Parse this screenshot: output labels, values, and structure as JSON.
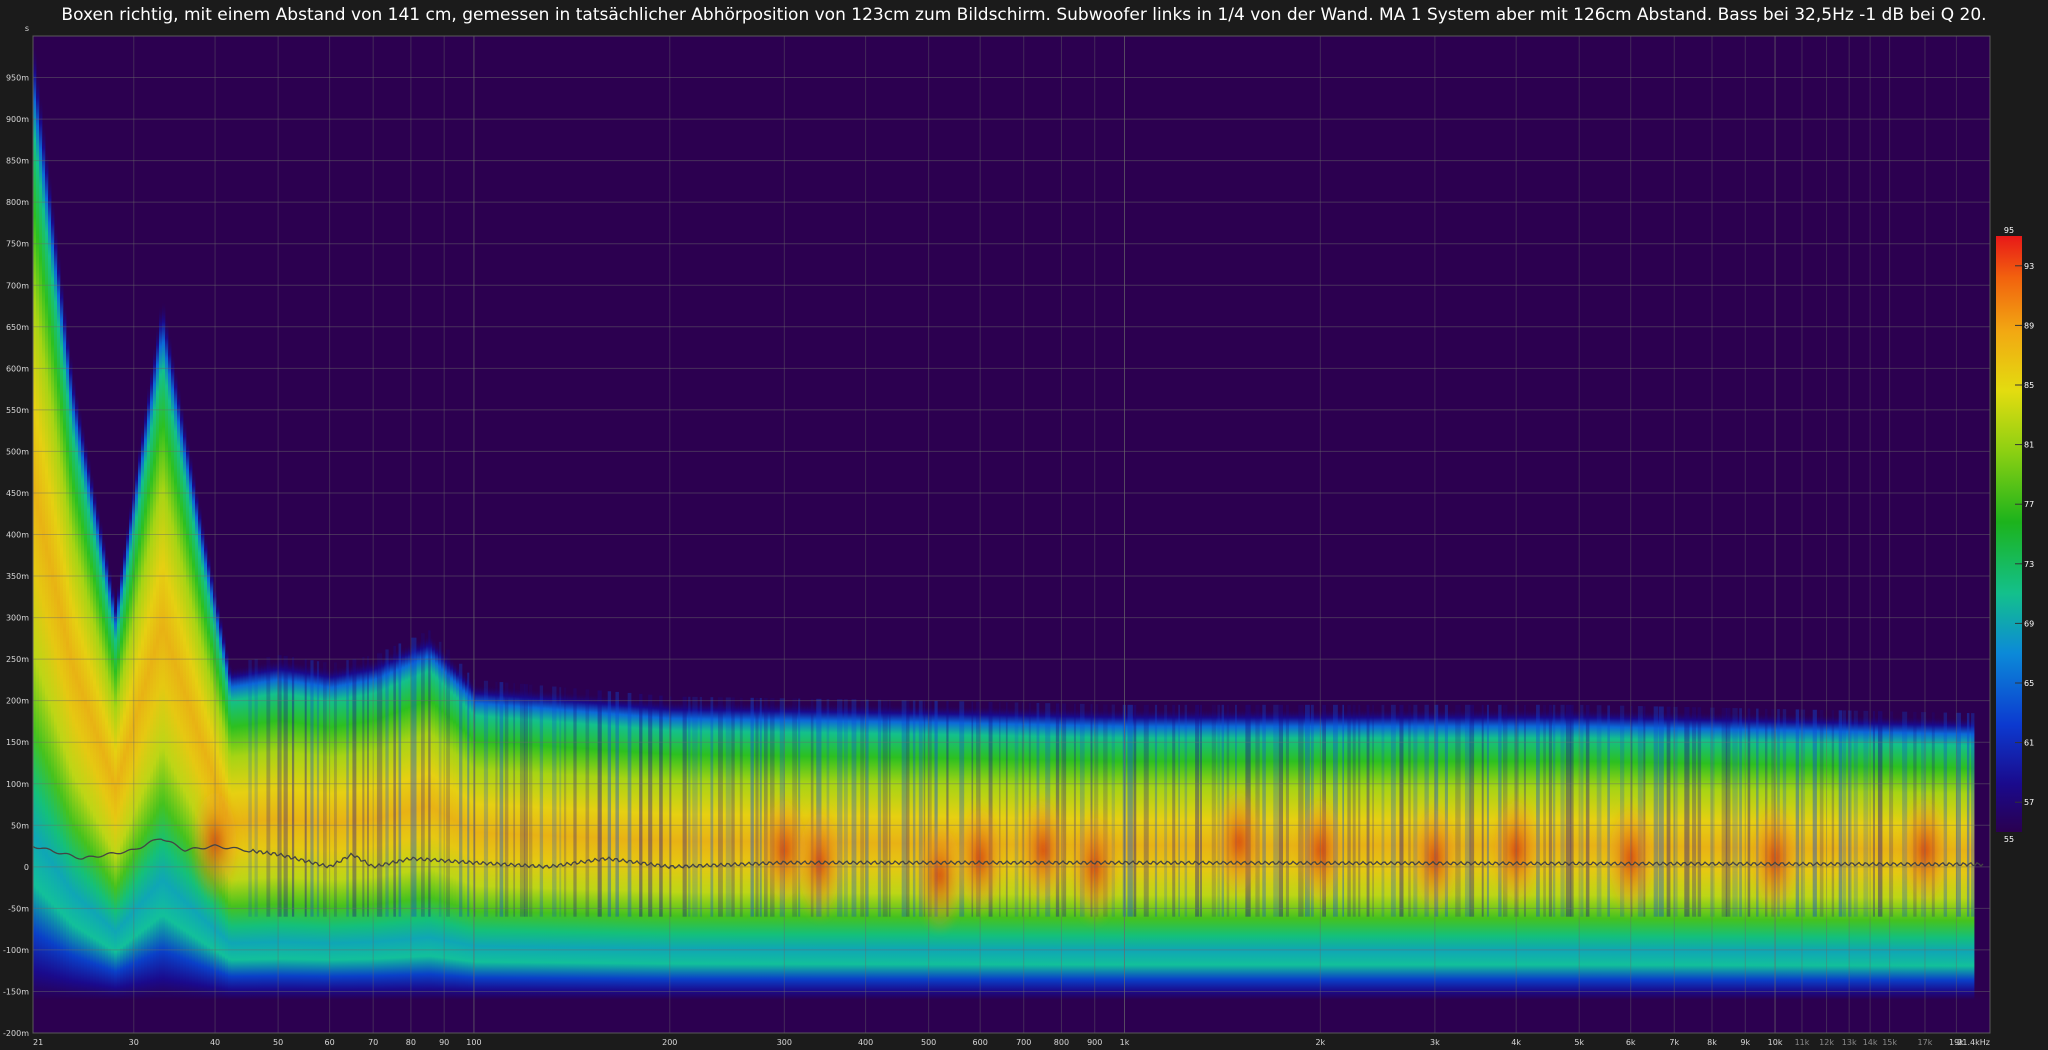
{
  "chart_data": {
    "type": "heatmap",
    "title": "Boxen richtig, mit einem Abstand von 141 cm, gemessen in tatsächlicher Abhörposition von 123cm zum Bildschirm. Subwoofer links in 1/4 von der Wand. MA 1 System aber mit 126cm Abstand. Bass bei 32,5Hz -1 dB bei Q 20.",
    "x_scale": "log",
    "xlim": [
      21,
      21400
    ],
    "ylim": [
      -200,
      1000
    ],
    "y_unit_label": "s",
    "x_ticks": [
      {
        "value": 21,
        "label": "21"
      },
      {
        "value": 30,
        "label": "30"
      },
      {
        "value": 40,
        "label": "40"
      },
      {
        "value": 50,
        "label": "50"
      },
      {
        "value": 60,
        "label": "60"
      },
      {
        "value": 70,
        "label": "70"
      },
      {
        "value": 80,
        "label": "80"
      },
      {
        "value": 90,
        "label": "90"
      },
      {
        "value": 100,
        "label": "100"
      },
      {
        "value": 200,
        "label": "200"
      },
      {
        "value": 300,
        "label": "300"
      },
      {
        "value": 400,
        "label": "400"
      },
      {
        "value": 500,
        "label": "500"
      },
      {
        "value": 600,
        "label": "600"
      },
      {
        "value": 700,
        "label": "700"
      },
      {
        "value": 800,
        "label": "800"
      },
      {
        "value": 900,
        "label": "900"
      },
      {
        "value": 1000,
        "label": "1k"
      },
      {
        "value": 2000,
        "label": "2k"
      },
      {
        "value": 3000,
        "label": "3k"
      },
      {
        "value": 4000,
        "label": "4k"
      },
      {
        "value": 5000,
        "label": "5k"
      },
      {
        "value": 6000,
        "label": "6k"
      },
      {
        "value": 7000,
        "label": "7k"
      },
      {
        "value": 8000,
        "label": "8k"
      },
      {
        "value": 9000,
        "label": "9k"
      },
      {
        "value": 10000,
        "label": "10k"
      },
      {
        "value": 11000,
        "label": "11k"
      },
      {
        "value": 12000,
        "label": "12k"
      },
      {
        "value": 13000,
        "label": "13k"
      },
      {
        "value": 14000,
        "label": "14k"
      },
      {
        "value": 15000,
        "label": "15k"
      },
      {
        "value": 17000,
        "label": "17k"
      },
      {
        "value": 19000,
        "label": "19k"
      },
      {
        "value": 21400,
        "label": "21.4kHz"
      }
    ],
    "y_ticks": [
      {
        "value": 950,
        "label": "950m"
      },
      {
        "value": 900,
        "label": "900m"
      },
      {
        "value": 850,
        "label": "850m"
      },
      {
        "value": 800,
        "label": "800m"
      },
      {
        "value": 750,
        "label": "750m"
      },
      {
        "value": 700,
        "label": "700m"
      },
      {
        "value": 650,
        "label": "650m"
      },
      {
        "value": 600,
        "label": "600m"
      },
      {
        "value": 550,
        "label": "550m"
      },
      {
        "value": 500,
        "label": "500m"
      },
      {
        "value": 450,
        "label": "450m"
      },
      {
        "value": 400,
        "label": "400m"
      },
      {
        "value": 350,
        "label": "350m"
      },
      {
        "value": 300,
        "label": "300m"
      },
      {
        "value": 250,
        "label": "250m"
      },
      {
        "value": 200,
        "label": "200m"
      },
      {
        "value": 150,
        "label": "150m"
      },
      {
        "value": 100,
        "label": "100m"
      },
      {
        "value": 50,
        "label": "50m"
      },
      {
        "value": 0,
        "label": "0"
      },
      {
        "value": -50,
        "label": "-50m"
      },
      {
        "value": -100,
        "label": "-100m"
      },
      {
        "value": -150,
        "label": "-150m"
      },
      {
        "value": -200,
        "label": "-200m"
      }
    ],
    "colorbar": {
      "min": 55,
      "max": 95,
      "ticks": [
        "95",
        "93",
        "89",
        "85",
        "81",
        "77",
        "73",
        "69",
        "65",
        "61",
        "57",
        "55"
      ],
      "colors": [
        "#2a0050",
        "#1a0a8c",
        "#0c3ad0",
        "#0c8ad8",
        "#13c08c",
        "#1cb31c",
        "#8ed012",
        "#e3dc10",
        "#f2a812",
        "#f2620e",
        "#e81818"
      ]
    },
    "bands": [
      {
        "x": 21,
        "top": 990,
        "bottom": -160
      },
      {
        "x": 24,
        "top": 600,
        "bottom": -160
      },
      {
        "x": 28,
        "top": 320,
        "bottom": -160
      },
      {
        "x": 33,
        "top": 690,
        "bottom": -160
      },
      {
        "x": 38,
        "top": 420,
        "bottom": -160
      },
      {
        "x": 42,
        "top": 240,
        "bottom": -160
      },
      {
        "x": 50,
        "top": 250,
        "bottom": -160
      },
      {
        "x": 60,
        "top": 240,
        "bottom": -160
      },
      {
        "x": 70,
        "top": 250,
        "bottom": -160
      },
      {
        "x": 85,
        "top": 280,
        "bottom": -160
      },
      {
        "x": 100,
        "top": 220,
        "bottom": -160
      },
      {
        "x": 200,
        "top": 200,
        "bottom": -160
      },
      {
        "x": 500,
        "top": 195,
        "bottom": -160
      },
      {
        "x": 1000,
        "top": 190,
        "bottom": -160
      },
      {
        "x": 5000,
        "top": 190,
        "bottom": -160
      },
      {
        "x": 20000,
        "top": 180,
        "bottom": -160
      }
    ],
    "hot_spots": [
      {
        "x": 40,
        "y": 30,
        "level": 91
      },
      {
        "x": 300,
        "y": 20,
        "level": 91
      },
      {
        "x": 340,
        "y": 5,
        "level": 90
      },
      {
        "x": 520,
        "y": -10,
        "level": 91
      },
      {
        "x": 600,
        "y": 10,
        "level": 92
      },
      {
        "x": 750,
        "y": 20,
        "level": 91
      },
      {
        "x": 900,
        "y": 0,
        "level": 90
      },
      {
        "x": 1500,
        "y": 30,
        "level": 93
      },
      {
        "x": 2000,
        "y": 20,
        "level": 91
      },
      {
        "x": 3000,
        "y": 10,
        "level": 91
      },
      {
        "x": 4000,
        "y": 20,
        "level": 90
      },
      {
        "x": 6000,
        "y": 10,
        "level": 90
      },
      {
        "x": 10000,
        "y": 10,
        "level": 91
      },
      {
        "x": 17000,
        "y": 20,
        "level": 90
      }
    ],
    "impulse_line": {
      "x": [
        21,
        25,
        30,
        33,
        36,
        40,
        50,
        60,
        65,
        70,
        80,
        100,
        130,
        160,
        200,
        300,
        500,
        1000,
        21000
      ],
      "y": [
        25,
        10,
        20,
        35,
        20,
        25,
        15,
        0,
        15,
        0,
        10,
        5,
        0,
        10,
        0,
        5,
        5,
        5,
        3
      ]
    }
  }
}
